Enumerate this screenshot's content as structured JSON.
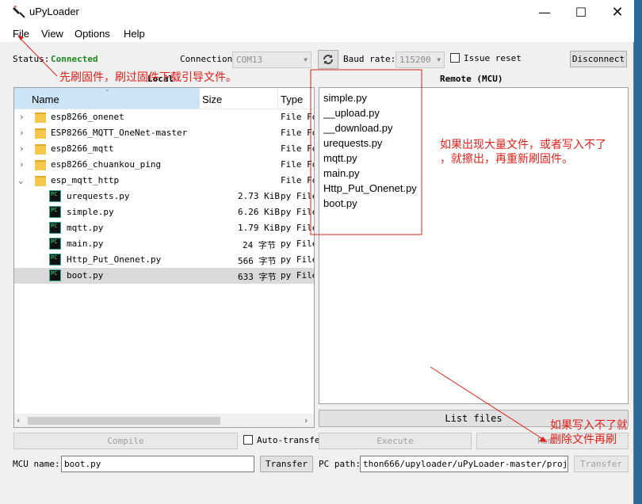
{
  "window": {
    "title": "uPyLoader"
  },
  "menu": {
    "items": [
      "File",
      "View",
      "Options",
      "Help"
    ]
  },
  "status": {
    "label": "Status:",
    "value": "Connected",
    "value_color": "#1a8a1a"
  },
  "connection": {
    "label": "Connection",
    "port": "COM13",
    "baud_label": "Baud rate:",
    "baud": "115200",
    "issue_reset": "Issue reset",
    "disconnect": "Disconnect"
  },
  "local": {
    "header": "Local",
    "columns": {
      "name": "Name",
      "size": "Size",
      "type": "Type"
    },
    "rows": [
      {
        "name": "esp8266_onenet",
        "size": "",
        "type": "File Fo"
      },
      {
        "name": "ESP8266_MQTT_OneNet-master",
        "size": "",
        "type": "File Fo"
      },
      {
        "name": "esp8266_mqtt",
        "size": "",
        "type": "File Fo"
      },
      {
        "name": "esp8266_chuankou_ping",
        "size": "",
        "type": "File Fo"
      },
      {
        "name": "esp_mqtt_http",
        "size": "",
        "type": "File Fo"
      },
      {
        "name": "urequests.py",
        "size": "2.73 KiB",
        "type": "py File"
      },
      {
        "name": "simple.py",
        "size": "6.26 KiB",
        "type": "py File"
      },
      {
        "name": "mqtt.py",
        "size": "1.79 KiB",
        "type": "py File"
      },
      {
        "name": "main.py",
        "size": "24 字节",
        "type": "py File"
      },
      {
        "name": "Http_Put_Onenet.py",
        "size": "566 字节",
        "type": "py File"
      },
      {
        "name": "boot.py",
        "size": "633 字节",
        "type": "py File"
      }
    ]
  },
  "remote": {
    "header": "Remote (MCU)",
    "files": [
      "simple.py",
      "__upload.py",
      "__download.py",
      "urequests.py",
      "mqtt.py",
      "main.py",
      "Http_Put_Onenet.py",
      "boot.py"
    ],
    "list_files": "List files"
  },
  "actions": {
    "compile": "Compile",
    "auto_transfer": "Auto-transfe",
    "execute": "Execute",
    "remove": "Rem"
  },
  "bottom": {
    "mcu_name_label": "MCU name:",
    "mcu_name": "boot.py",
    "transfer": "Transfer",
    "pc_path_label": "PC path:",
    "pc_path": "thon666/upyloader/uPyLoader-master/projects",
    "transfer2": "Transfer"
  },
  "annotations": {
    "a1": "先刷固件，刷过固件下载引导文件。",
    "a2_line1": "如果出现大量文件，或者写入不了",
    "a2_line2": "，就擦出，再重新刷固件。",
    "a3_line1": "如果写入不了就",
    "a3_line2": "删除文件再刷"
  },
  "colors": {
    "annotation": "#e0201a",
    "selected_row": "#d9d9d9",
    "header_bg": "#cce4f7"
  }
}
